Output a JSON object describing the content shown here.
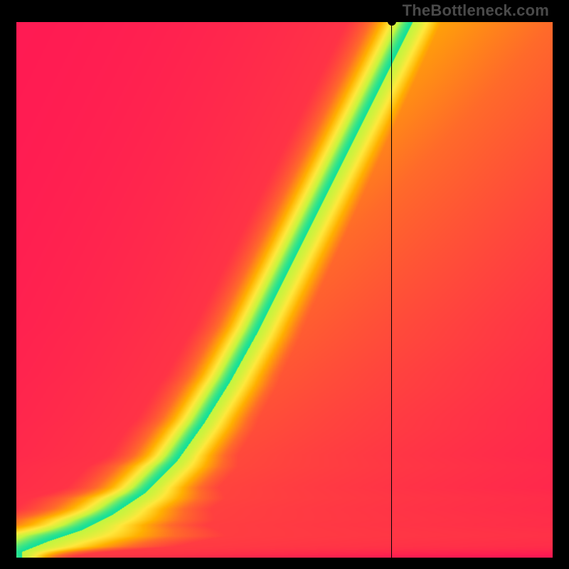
{
  "brand": "TheBottleneck.com",
  "chart_data": {
    "type": "heatmap",
    "title": "",
    "xlabel": "",
    "ylabel": "",
    "xlim": [
      0,
      1
    ],
    "ylim": [
      0,
      1
    ],
    "grid": false,
    "legend": false,
    "marker": {
      "x": 0.7,
      "y": 1.0
    },
    "crosshair": {
      "x": 0.7,
      "y": 1.0
    },
    "ridge": {
      "description": "green optimal band through the heatmap; points are (x, y) fractions of the plot area, y=0 at bottom",
      "points": [
        [
          0.01,
          0.01
        ],
        [
          0.06,
          0.03
        ],
        [
          0.12,
          0.05
        ],
        [
          0.18,
          0.08
        ],
        [
          0.24,
          0.12
        ],
        [
          0.3,
          0.18
        ],
        [
          0.35,
          0.25
        ],
        [
          0.4,
          0.33
        ],
        [
          0.45,
          0.42
        ],
        [
          0.5,
          0.52
        ],
        [
          0.55,
          0.62
        ],
        [
          0.6,
          0.72
        ],
        [
          0.65,
          0.82
        ],
        [
          0.7,
          0.92
        ],
        [
          0.74,
          1.0
        ]
      ],
      "width": 0.07
    },
    "colorscale": [
      {
        "t": 0.0,
        "hex": "#ff1a53"
      },
      {
        "t": 0.35,
        "hex": "#ff6a2a"
      },
      {
        "t": 0.55,
        "hex": "#ffb000"
      },
      {
        "t": 0.72,
        "hex": "#ffe83c"
      },
      {
        "t": 0.85,
        "hex": "#c6f53e"
      },
      {
        "t": 1.0,
        "hex": "#12e09b"
      }
    ],
    "corner_scores": {
      "description": "approximate field value at the four corners, 0=red 1=green",
      "bottom_left": 0.05,
      "bottom_right": 0.0,
      "top_left": 0.0,
      "top_right": 0.55
    }
  }
}
